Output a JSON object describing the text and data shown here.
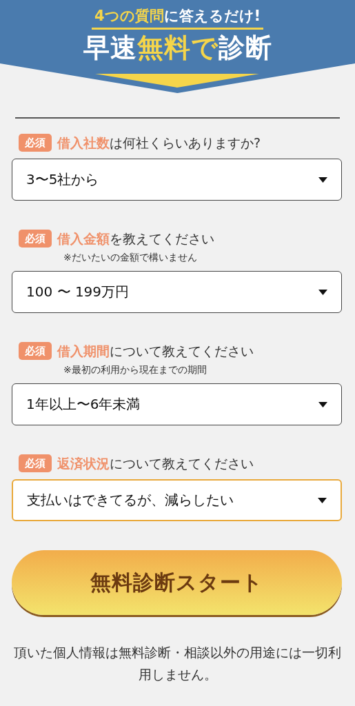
{
  "header": {
    "tagline": [
      {
        "text": "4つの質問",
        "highlight": true
      },
      {
        "text": "に答えるだけ!",
        "highlight": false
      }
    ],
    "headline": [
      {
        "text": "早速",
        "highlight": false
      },
      {
        "text": "無料で",
        "highlight": true
      },
      {
        "text": "診断",
        "highlight": false
      }
    ]
  },
  "questions": [
    {
      "badge": "必須",
      "label": [
        {
          "text": "借入社数",
          "emphasis": true
        },
        {
          "text": "は何社くらいありますか?",
          "emphasis": false
        }
      ],
      "value": "3〜5社から",
      "focused": false
    },
    {
      "badge": "必須",
      "label": [
        {
          "text": "借入金額",
          "emphasis": true
        },
        {
          "text": "を教えてください",
          "emphasis": false
        }
      ],
      "note": "※だいたいの金額で構いません",
      "value": "100 〜 199万円",
      "focused": false
    },
    {
      "badge": "必須",
      "label": [
        {
          "text": "借入期間",
          "emphasis": true
        },
        {
          "text": "について教えてください",
          "emphasis": false
        }
      ],
      "note": "※最初の利用から現在までの期間",
      "value": "1年以上〜6年未満",
      "focused": false
    },
    {
      "badge": "必須",
      "label": [
        {
          "text": "返済状況",
          "emphasis": true
        },
        {
          "text": "について教えてください",
          "emphasis": false
        }
      ],
      "value": "支払いはできてるが、減らしたい",
      "focused": true
    }
  ],
  "submit_button": "無料診断スタート",
  "disclaimer": "頂いた個人情報は無料診断・相談以外の用途には一切利用しません。"
}
